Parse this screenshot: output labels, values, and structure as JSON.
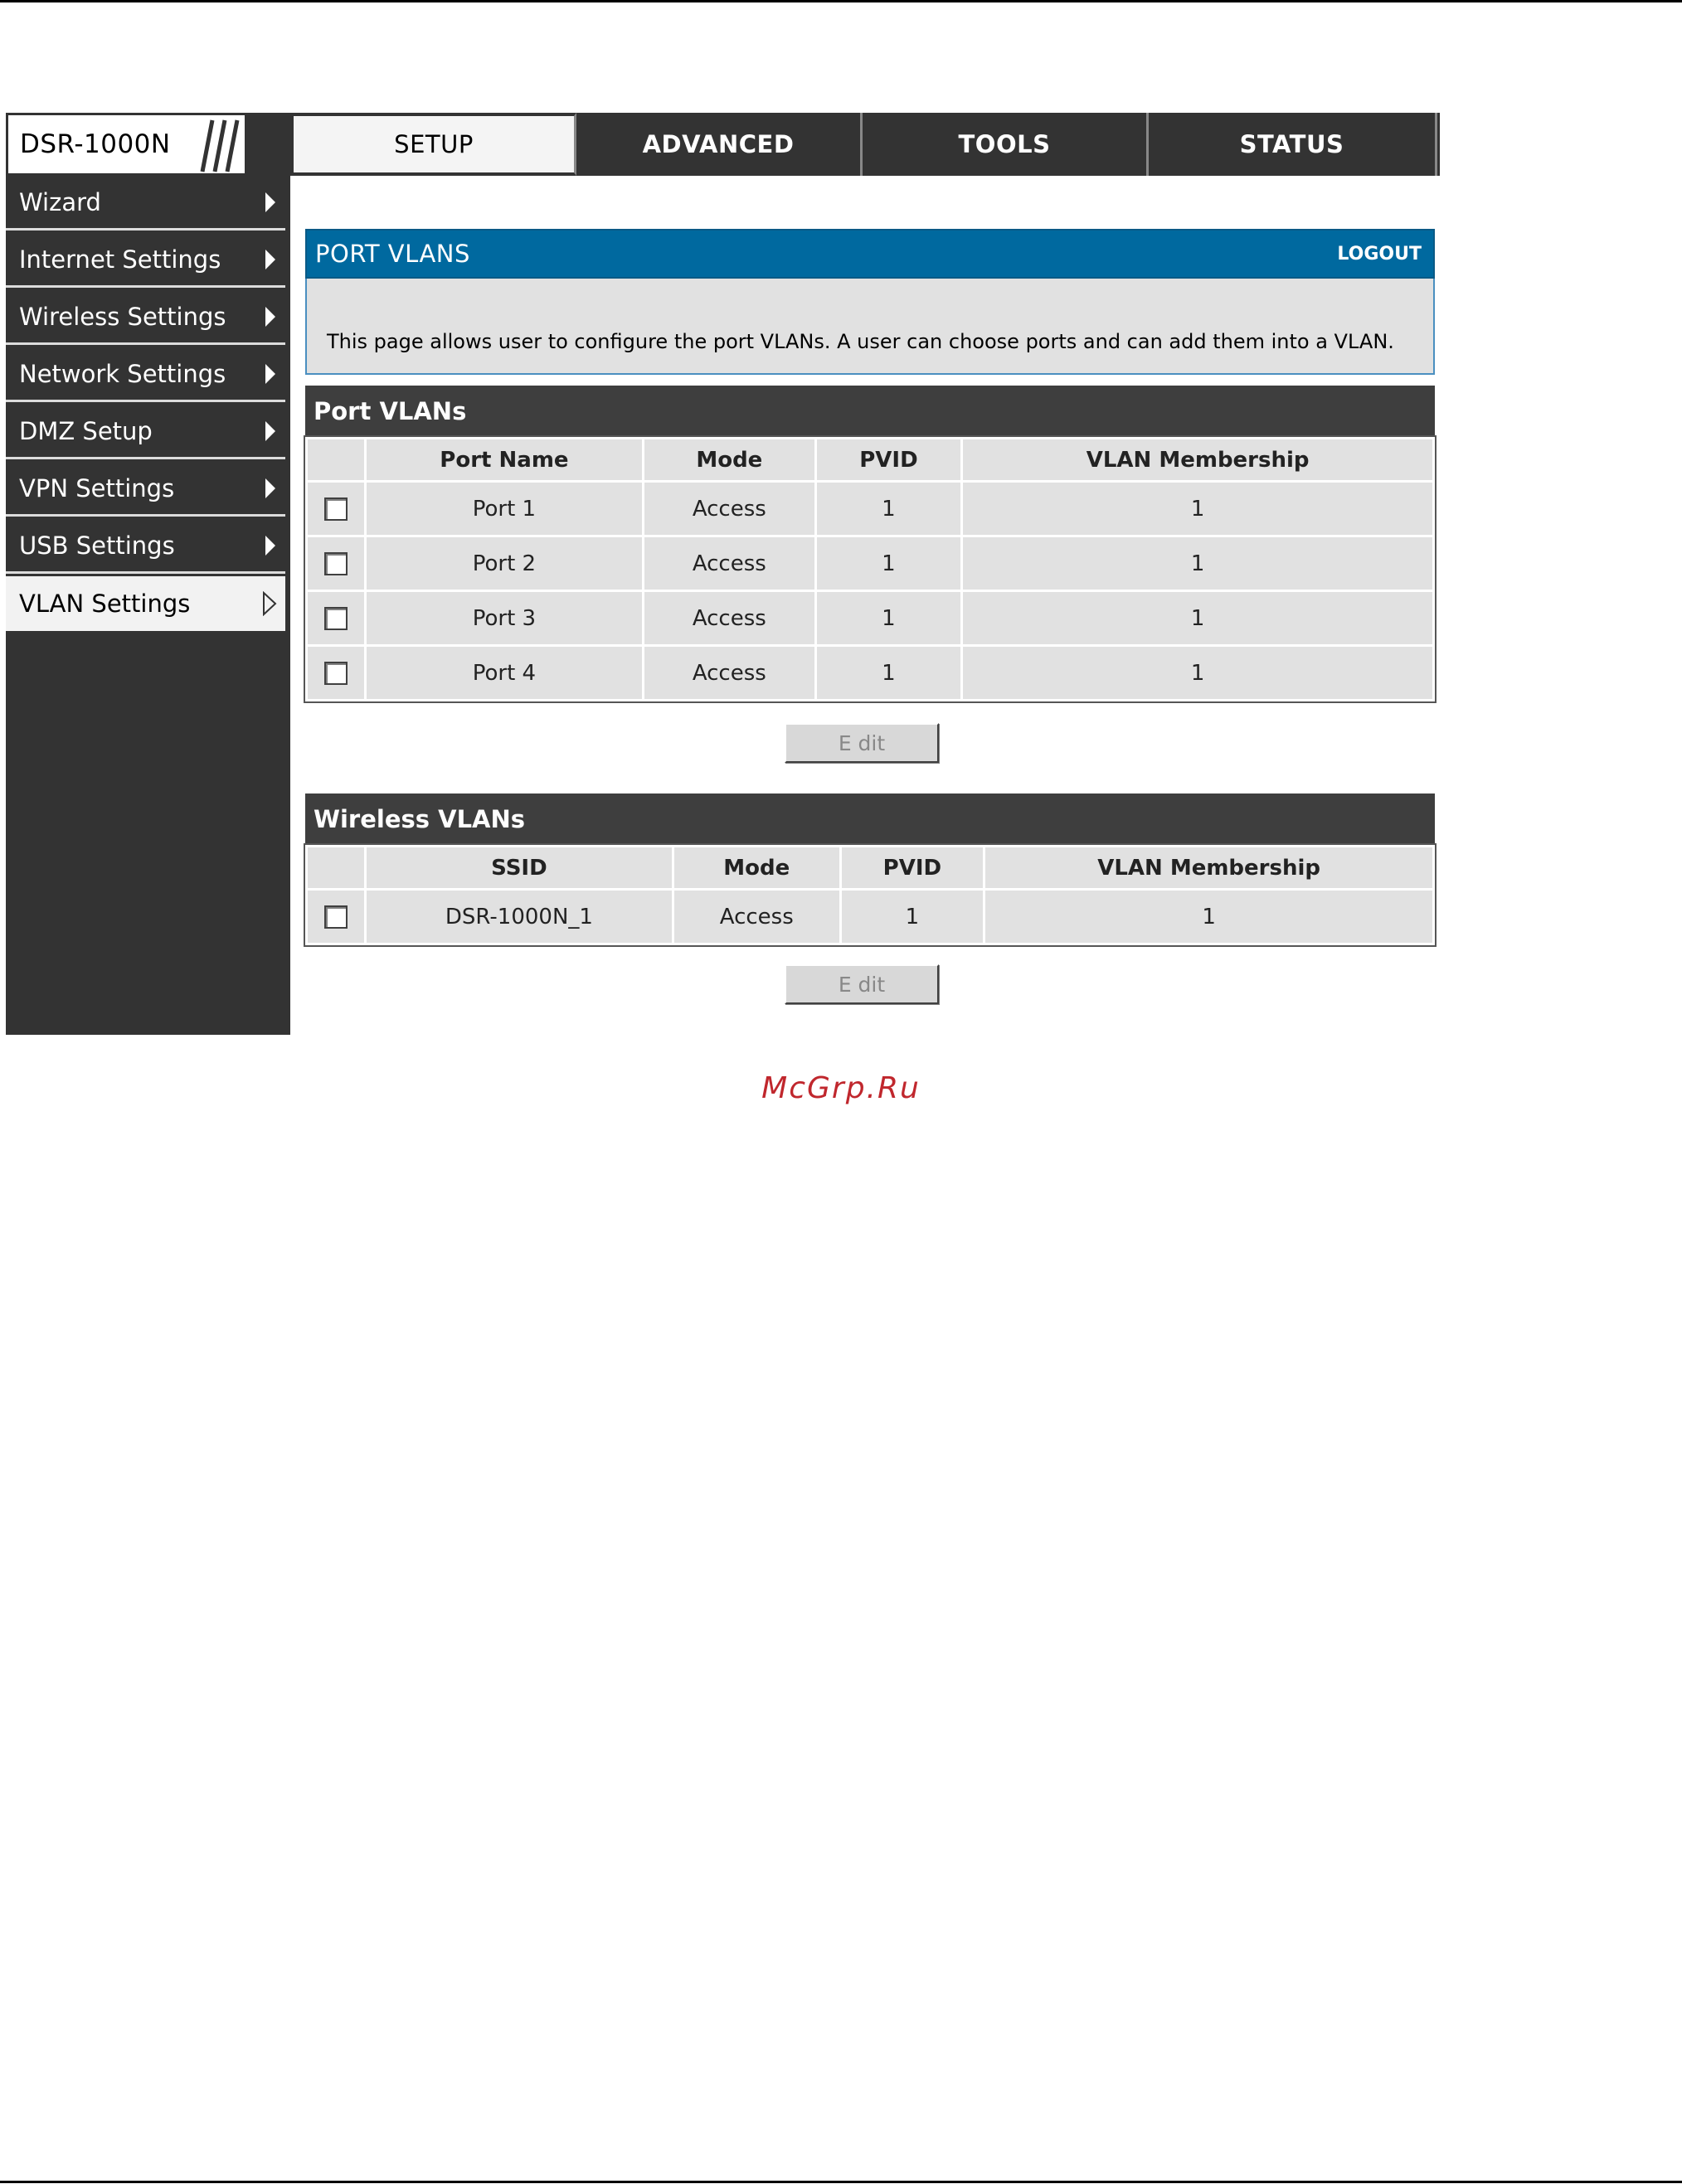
{
  "header": {
    "product": "DSR-1000N",
    "tabs": [
      {
        "label": "SETUP",
        "active": true
      },
      {
        "label": "ADVANCED",
        "active": false
      },
      {
        "label": "TOOLS",
        "active": false
      },
      {
        "label": "STATUS",
        "active": false
      }
    ]
  },
  "sidebar": {
    "items": [
      {
        "label": "Wizard",
        "active": false
      },
      {
        "label": "Internet Settings",
        "active": false
      },
      {
        "label": "Wireless Settings",
        "active": false
      },
      {
        "label": "Network Settings",
        "active": false
      },
      {
        "label": "DMZ Setup",
        "active": false
      },
      {
        "label": "VPN Settings",
        "active": false
      },
      {
        "label": "USB Settings",
        "active": false
      },
      {
        "label": "VLAN Settings",
        "active": true
      }
    ]
  },
  "main": {
    "title": "PORT VLANS",
    "logout": "LOGOUT",
    "description": "This page allows user to configure the port VLANs. A user can choose ports and can add them into a VLAN.",
    "port_vlans": {
      "heading": "Port VLANs",
      "columns": [
        "Port Name",
        "Mode",
        "PVID",
        "VLAN Membership"
      ],
      "rows": [
        {
          "name": "Port 1",
          "mode": "Access",
          "pvid": "1",
          "membership": "1",
          "checked": false
        },
        {
          "name": "Port 2",
          "mode": "Access",
          "pvid": "1",
          "membership": "1",
          "checked": false
        },
        {
          "name": "Port 3",
          "mode": "Access",
          "pvid": "1",
          "membership": "1",
          "checked": false
        },
        {
          "name": "Port 4",
          "mode": "Access",
          "pvid": "1",
          "membership": "1",
          "checked": false
        }
      ],
      "edit_label": "E dit"
    },
    "wireless_vlans": {
      "heading": "Wireless VLANs",
      "columns": [
        "SSID",
        "Mode",
        "PVID",
        "VLAN Membership"
      ],
      "rows": [
        {
          "name": "DSR-1000N_1",
          "mode": "Access",
          "pvid": "1",
          "membership": "1",
          "checked": false
        }
      ],
      "edit_label": "E dit"
    }
  },
  "watermark": "McGrp.Ru",
  "colors": {
    "title_bar": "#00699f",
    "nav_dark": "#333333",
    "section_head": "#3e3e3e",
    "table_bg": "#e1e1e1",
    "watermark": "#c0272d"
  }
}
